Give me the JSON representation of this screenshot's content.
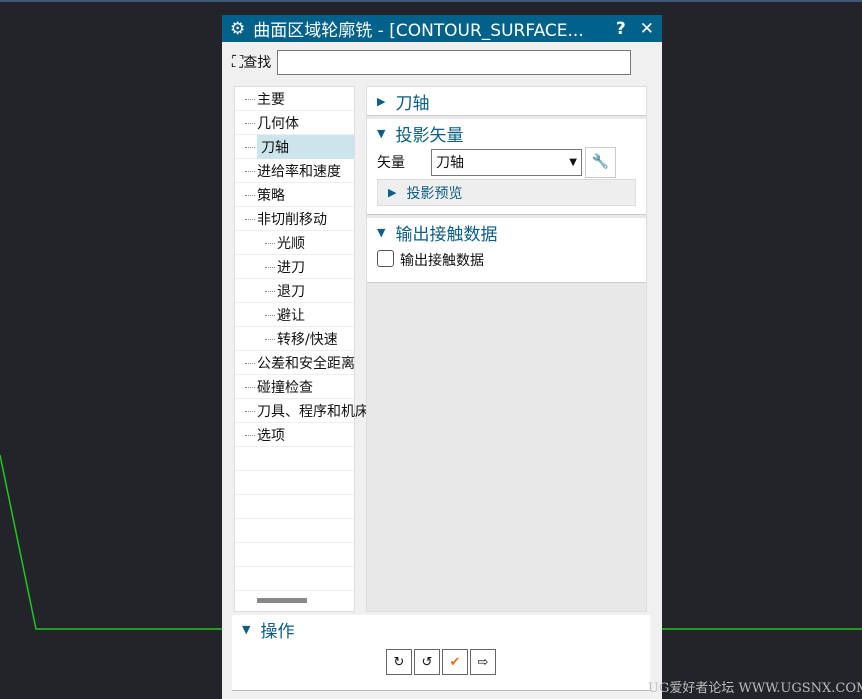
{
  "title": "曲面区域轮廓铣 - [CONTOUR_SURFACE...",
  "help": "?",
  "close": "✕",
  "search_label": "查找",
  "search_value": "",
  "tree": [
    {
      "label": "主要",
      "sub": false
    },
    {
      "label": "几何体",
      "sub": false
    },
    {
      "label": "刀轴",
      "sub": false,
      "selected": true
    },
    {
      "label": "进给率和速度",
      "sub": false
    },
    {
      "label": "策略",
      "sub": false
    },
    {
      "label": "非切削移动",
      "sub": false
    },
    {
      "label": "光顺",
      "sub": true
    },
    {
      "label": "进刀",
      "sub": true
    },
    {
      "label": "退刀",
      "sub": true
    },
    {
      "label": "避让",
      "sub": true
    },
    {
      "label": "转移/快速",
      "sub": true
    },
    {
      "label": "公差和安全距离",
      "sub": false
    },
    {
      "label": "碰撞检查",
      "sub": false
    },
    {
      "label": "刀具、程序和机床",
      "sub": false
    },
    {
      "label": "选项",
      "sub": false
    }
  ],
  "sections": {
    "tool_axis": "刀轴",
    "proj": "投影矢量",
    "vector_label": "矢量",
    "vector_value": "刀轴",
    "preview": "投影预览",
    "output": "输出接触数据",
    "output_cb": "输出接触数据",
    "output_checked": false
  },
  "ops": {
    "title": "操作"
  },
  "watermark": "UG爱好者论坛 WWW.UGSNX.COM"
}
